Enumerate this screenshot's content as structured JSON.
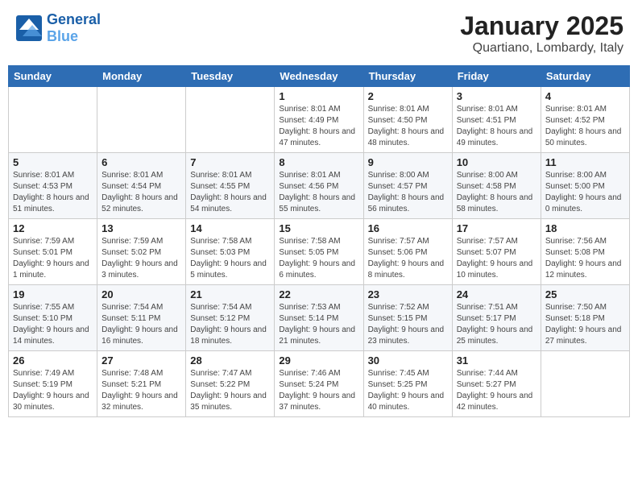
{
  "header": {
    "logo_text_general": "General",
    "logo_text_blue": "Blue",
    "title": "January 2025",
    "subtitle": "Quartiano, Lombardy, Italy"
  },
  "calendar": {
    "weekdays": [
      "Sunday",
      "Monday",
      "Tuesday",
      "Wednesday",
      "Thursday",
      "Friday",
      "Saturday"
    ],
    "weeks": [
      [
        {
          "day": "",
          "info": ""
        },
        {
          "day": "",
          "info": ""
        },
        {
          "day": "",
          "info": ""
        },
        {
          "day": "1",
          "info": "Sunrise: 8:01 AM\nSunset: 4:49 PM\nDaylight: 8 hours and 47 minutes."
        },
        {
          "day": "2",
          "info": "Sunrise: 8:01 AM\nSunset: 4:50 PM\nDaylight: 8 hours and 48 minutes."
        },
        {
          "day": "3",
          "info": "Sunrise: 8:01 AM\nSunset: 4:51 PM\nDaylight: 8 hours and 49 minutes."
        },
        {
          "day": "4",
          "info": "Sunrise: 8:01 AM\nSunset: 4:52 PM\nDaylight: 8 hours and 50 minutes."
        }
      ],
      [
        {
          "day": "5",
          "info": "Sunrise: 8:01 AM\nSunset: 4:53 PM\nDaylight: 8 hours and 51 minutes."
        },
        {
          "day": "6",
          "info": "Sunrise: 8:01 AM\nSunset: 4:54 PM\nDaylight: 8 hours and 52 minutes."
        },
        {
          "day": "7",
          "info": "Sunrise: 8:01 AM\nSunset: 4:55 PM\nDaylight: 8 hours and 54 minutes."
        },
        {
          "day": "8",
          "info": "Sunrise: 8:01 AM\nSunset: 4:56 PM\nDaylight: 8 hours and 55 minutes."
        },
        {
          "day": "9",
          "info": "Sunrise: 8:00 AM\nSunset: 4:57 PM\nDaylight: 8 hours and 56 minutes."
        },
        {
          "day": "10",
          "info": "Sunrise: 8:00 AM\nSunset: 4:58 PM\nDaylight: 8 hours and 58 minutes."
        },
        {
          "day": "11",
          "info": "Sunrise: 8:00 AM\nSunset: 5:00 PM\nDaylight: 9 hours and 0 minutes."
        }
      ],
      [
        {
          "day": "12",
          "info": "Sunrise: 7:59 AM\nSunset: 5:01 PM\nDaylight: 9 hours and 1 minute."
        },
        {
          "day": "13",
          "info": "Sunrise: 7:59 AM\nSunset: 5:02 PM\nDaylight: 9 hours and 3 minutes."
        },
        {
          "day": "14",
          "info": "Sunrise: 7:58 AM\nSunset: 5:03 PM\nDaylight: 9 hours and 5 minutes."
        },
        {
          "day": "15",
          "info": "Sunrise: 7:58 AM\nSunset: 5:05 PM\nDaylight: 9 hours and 6 minutes."
        },
        {
          "day": "16",
          "info": "Sunrise: 7:57 AM\nSunset: 5:06 PM\nDaylight: 9 hours and 8 minutes."
        },
        {
          "day": "17",
          "info": "Sunrise: 7:57 AM\nSunset: 5:07 PM\nDaylight: 9 hours and 10 minutes."
        },
        {
          "day": "18",
          "info": "Sunrise: 7:56 AM\nSunset: 5:08 PM\nDaylight: 9 hours and 12 minutes."
        }
      ],
      [
        {
          "day": "19",
          "info": "Sunrise: 7:55 AM\nSunset: 5:10 PM\nDaylight: 9 hours and 14 minutes."
        },
        {
          "day": "20",
          "info": "Sunrise: 7:54 AM\nSunset: 5:11 PM\nDaylight: 9 hours and 16 minutes."
        },
        {
          "day": "21",
          "info": "Sunrise: 7:54 AM\nSunset: 5:12 PM\nDaylight: 9 hours and 18 minutes."
        },
        {
          "day": "22",
          "info": "Sunrise: 7:53 AM\nSunset: 5:14 PM\nDaylight: 9 hours and 21 minutes."
        },
        {
          "day": "23",
          "info": "Sunrise: 7:52 AM\nSunset: 5:15 PM\nDaylight: 9 hours and 23 minutes."
        },
        {
          "day": "24",
          "info": "Sunrise: 7:51 AM\nSunset: 5:17 PM\nDaylight: 9 hours and 25 minutes."
        },
        {
          "day": "25",
          "info": "Sunrise: 7:50 AM\nSunset: 5:18 PM\nDaylight: 9 hours and 27 minutes."
        }
      ],
      [
        {
          "day": "26",
          "info": "Sunrise: 7:49 AM\nSunset: 5:19 PM\nDaylight: 9 hours and 30 minutes."
        },
        {
          "day": "27",
          "info": "Sunrise: 7:48 AM\nSunset: 5:21 PM\nDaylight: 9 hours and 32 minutes."
        },
        {
          "day": "28",
          "info": "Sunrise: 7:47 AM\nSunset: 5:22 PM\nDaylight: 9 hours and 35 minutes."
        },
        {
          "day": "29",
          "info": "Sunrise: 7:46 AM\nSunset: 5:24 PM\nDaylight: 9 hours and 37 minutes."
        },
        {
          "day": "30",
          "info": "Sunrise: 7:45 AM\nSunset: 5:25 PM\nDaylight: 9 hours and 40 minutes."
        },
        {
          "day": "31",
          "info": "Sunrise: 7:44 AM\nSunset: 5:27 PM\nDaylight: 9 hours and 42 minutes."
        },
        {
          "day": "",
          "info": ""
        }
      ]
    ]
  }
}
